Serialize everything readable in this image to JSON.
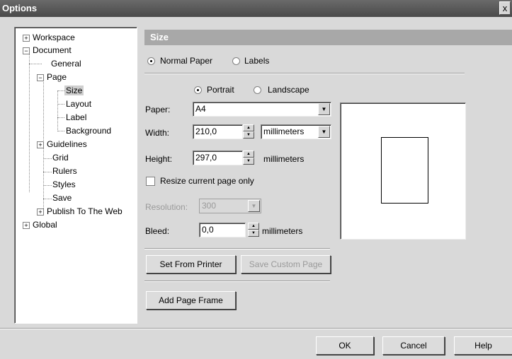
{
  "window": {
    "title": "Options",
    "close_label": "x"
  },
  "tree": {
    "workspace": "Workspace",
    "document": "Document",
    "general": "General",
    "page": "Page",
    "size": "Size",
    "layout": "Layout",
    "label": "Label",
    "background": "Background",
    "guidelines": "Guidelines",
    "grid": "Grid",
    "rulers": "Rulers",
    "styles": "Styles",
    "save": "Save",
    "publish": "Publish To The Web",
    "global": "Global",
    "plus": "+",
    "minus": "−"
  },
  "panel": {
    "title": "Size",
    "normal_paper": "Normal Paper",
    "labels": "Labels",
    "portrait": "Portrait",
    "landscape": "Landscape",
    "paper_label": "Paper:",
    "paper_value": "A4",
    "width_label": "Width:",
    "width_value": "210,0",
    "width_unit": "millimeters",
    "height_label": "Height:",
    "height_value": "297,0",
    "height_unit": "millimeters",
    "resize_label": "Resize current page only",
    "resolution_label": "Resolution:",
    "resolution_value": "300",
    "bleed_label": "Bleed:",
    "bleed_value": "0,0",
    "bleed_unit": "millimeters",
    "set_from_printer": "Set From Printer",
    "save_custom_page": "Save Custom Page",
    "add_page_frame": "Add Page Frame"
  },
  "footer": {
    "ok": "OK",
    "cancel": "Cancel",
    "help": "Help"
  }
}
